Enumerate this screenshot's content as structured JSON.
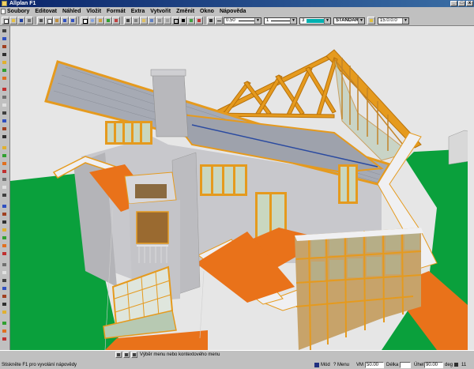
{
  "window": {
    "title": "Allplan F1",
    "min": "_",
    "max": "□",
    "close": "x"
  },
  "menu": {
    "items": [
      "Soubory",
      "Editovat",
      "Náhled",
      "Vložit",
      "Formát",
      "Extra",
      "Vytvořit",
      "Změnit",
      "Okno",
      "Nápověda"
    ]
  },
  "toolbar": {
    "pen_value": "0.50",
    "line_value": "1",
    "color_value": "3",
    "layer_value": "STANDARD",
    "scale_value": "15.0.0.0"
  },
  "status": {
    "tooltip_text": "Výběr menu nebo kontextového menu",
    "hint_text": "Stiskněte F1 pro vyvolání nápovědy",
    "mode_label": "Mód",
    "mode_value": "? Menu",
    "vm_label": "VM",
    "vm_value": "50.00",
    "length_label": "Délka",
    "angle_label": "Úhel",
    "angle_value": "90.00",
    "deg_label": "deg",
    "zoom_value": "11"
  },
  "colors": {
    "title_bar": "#0a246a",
    "chrome": "#c0c0c0",
    "lawn": "#0aa03c",
    "sky": "#e6e6e6",
    "timber": "#e59a1e",
    "wall": "#c8c8cc",
    "roof": "#a6aab4",
    "floor": "#e9721a",
    "glass": "#b7c9b2",
    "layer_swatch": "#00b0b0"
  }
}
